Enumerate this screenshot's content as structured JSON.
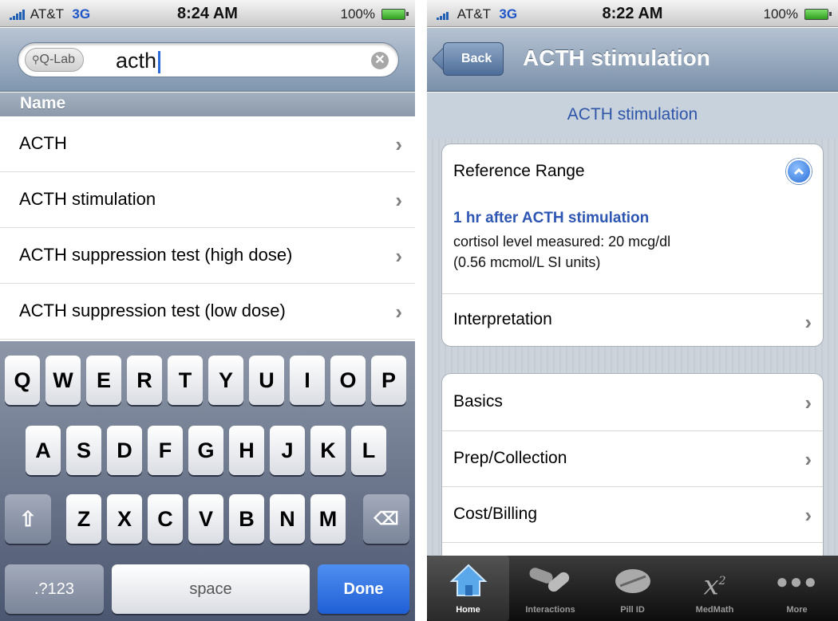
{
  "left": {
    "status": {
      "carrier": "AT&T",
      "network": "3G",
      "time": "8:24 AM",
      "battery": "100%"
    },
    "search": {
      "scope": "Q-Lab",
      "query": "acth",
      "clear_icon": "x-circle-icon"
    },
    "section_header": "Name",
    "results": [
      {
        "label": "ACTH"
      },
      {
        "label": "ACTH stimulation"
      },
      {
        "label": "ACTH suppression test (high dose)"
      },
      {
        "label": "ACTH suppression test (low dose)"
      }
    ],
    "keyboard": {
      "row1": [
        "Q",
        "W",
        "E",
        "R",
        "T",
        "Y",
        "U",
        "I",
        "O",
        "P"
      ],
      "row2": [
        "A",
        "S",
        "D",
        "F",
        "G",
        "H",
        "J",
        "K",
        "L"
      ],
      "row3": [
        "Z",
        "X",
        "C",
        "V",
        "B",
        "N",
        "M"
      ],
      "numbers": ".?123",
      "space": "space",
      "done": "Done"
    }
  },
  "right": {
    "status": {
      "carrier": "AT&T",
      "network": "3G",
      "time": "8:22 AM",
      "battery": "100%"
    },
    "nav": {
      "back": "Back",
      "title": "ACTH stimulation"
    },
    "subheader": "ACTH stimulation",
    "reference": {
      "title": "Reference Range",
      "subtitle": "1 hr after ACTH stimulation",
      "line1": "cortisol level measured: 20 mcg/dl",
      "line2": "(0.56 mcmol/L SI units)"
    },
    "interpretation": "Interpretation",
    "sections": [
      "Basics",
      "Prep/Collection",
      "Cost/Billing"
    ],
    "tabs": [
      {
        "label": "Home",
        "icon": "home-icon"
      },
      {
        "label": "Interactions",
        "icon": "pills-icon"
      },
      {
        "label": "Pill ID",
        "icon": "pill-icon"
      },
      {
        "label": "MedMath",
        "icon": "x-squared-icon"
      },
      {
        "label": "More",
        "icon": "more-dots-icon"
      }
    ]
  }
}
